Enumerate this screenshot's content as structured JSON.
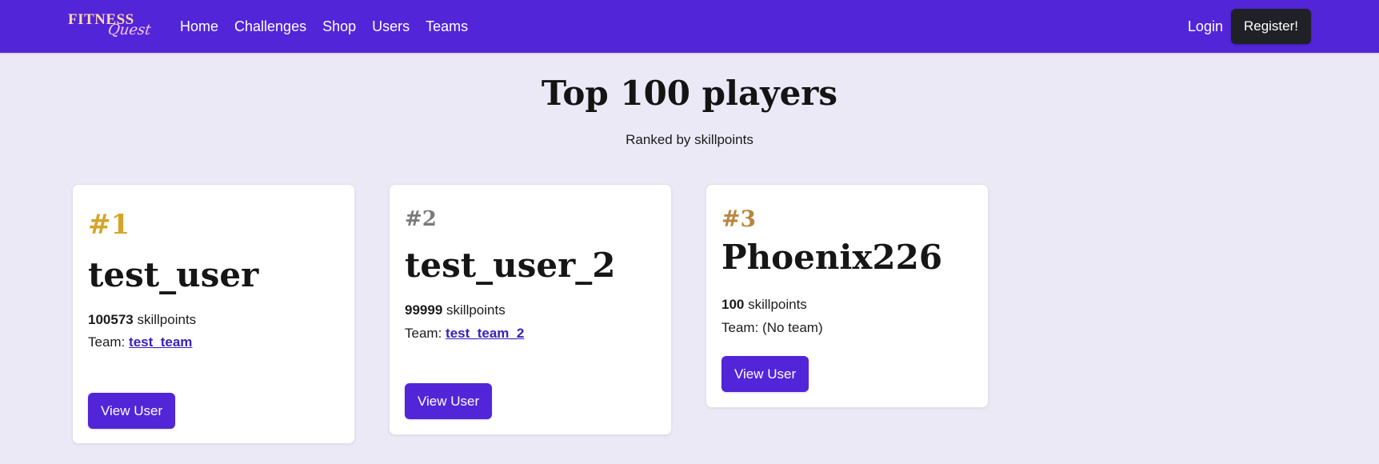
{
  "brand": {
    "line1": "FITNESS",
    "line2": "Quest"
  },
  "nav": {
    "links": [
      "Home",
      "Challenges",
      "Shop",
      "Users",
      "Teams"
    ],
    "login": "Login",
    "register": "Register!"
  },
  "header": {
    "title": "Top 100 players",
    "subtitle": "Ranked by skillpoints"
  },
  "colors": {
    "nav_background": "#5225d9",
    "page_background": "#ece9f7",
    "button_primary": "#5225d9",
    "register_button": "#1f2126",
    "rank_gold": "#d4a52a",
    "rank_silver": "#7a7a7a",
    "rank_bronze": "#b7863f"
  },
  "players": [
    {
      "rank": "#1",
      "name": "test_user",
      "skillpoints": "100573",
      "skill_label": "skillpoints",
      "team_label": "Team:",
      "team": "test_team",
      "view_label": "View User"
    },
    {
      "rank": "#2",
      "name": "test_user_2",
      "skillpoints": "99999",
      "skill_label": "skillpoints",
      "team_label": "Team:",
      "team": "test_team_2",
      "view_label": "View User"
    },
    {
      "rank": "#3",
      "name": "Phoenix226",
      "skillpoints": "100",
      "skill_label": "skillpoints",
      "team_label": "Team:",
      "team": "(No team)",
      "view_label": "View User"
    }
  ]
}
